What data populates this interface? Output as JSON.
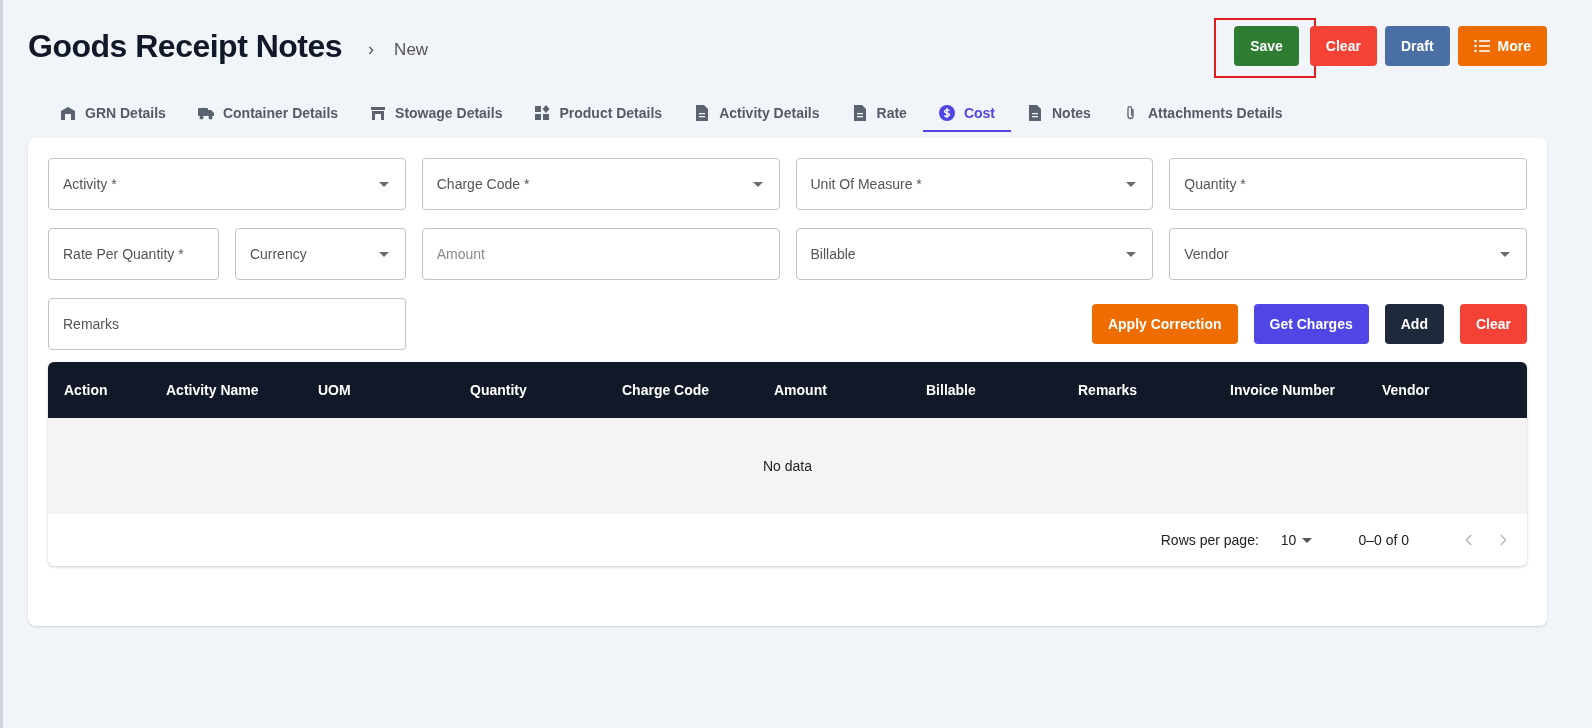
{
  "header": {
    "title": "Goods Receipt Notes",
    "separator": "›",
    "breadcrumb": "New"
  },
  "actions": [
    {
      "label": "Save",
      "kind": "success",
      "highlighted": true
    },
    {
      "label": "Clear",
      "kind": "danger",
      "highlighted": false
    },
    {
      "label": "Draft",
      "kind": "muted",
      "highlighted": false
    },
    {
      "label": "More",
      "kind": "warning",
      "highlighted": false,
      "menu_icon": true
    }
  ],
  "tabs": [
    {
      "label": "GRN Details",
      "selected": false
    },
    {
      "label": "Container Details",
      "selected": false
    },
    {
      "label": "Stowage Details",
      "selected": false
    },
    {
      "label": "Product Details",
      "selected": false
    },
    {
      "label": "Activity Details",
      "selected": false
    },
    {
      "label": "Rate",
      "selected": false
    },
    {
      "label": "Cost",
      "selected": true
    },
    {
      "label": "Notes",
      "selected": false
    },
    {
      "label": "Attachments Details",
      "selected": false
    }
  ],
  "form_rows": [
    [
      {
        "label": "Activity *",
        "kind": "select"
      },
      {
        "label": "Charge Code *",
        "kind": "select"
      },
      {
        "label": "Unit Of Measure *",
        "kind": "select"
      },
      {
        "label": "Quantity *",
        "kind": "text"
      }
    ],
    [
      {
        "label": "Rate Per Quantity *",
        "kind": "text"
      },
      {
        "label": "Currency",
        "kind": "select"
      },
      {
        "placeholder": "Amount",
        "kind": "input"
      },
      {
        "label": "Billable",
        "kind": "select"
      },
      {
        "label": "Vendor",
        "kind": "select"
      }
    ],
    [
      {
        "label": "Remarks",
        "kind": "text"
      }
    ]
  ],
  "form_buttons": [
    {
      "label": "Apply Correction",
      "kind": "warning"
    },
    {
      "label": "Get Charges",
      "kind": "primary"
    },
    {
      "label": "Add",
      "kind": "dark"
    },
    {
      "label": "Clear",
      "kind": "danger"
    }
  ],
  "table": {
    "columns": [
      "Action",
      "Activity Name",
      "UOM",
      "Quantity",
      "Charge Code",
      "Amount",
      "Billable",
      "Remarks",
      "Invoice Number",
      "Vendor"
    ],
    "empty_text": "No data",
    "footer": {
      "rows_per_page_label": "Rows per page:",
      "rows_per_page": "10",
      "range": "0–0 of 0"
    }
  }
}
